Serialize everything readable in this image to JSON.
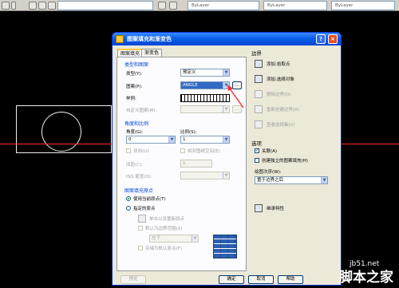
{
  "toolbar": {
    "combo_1": "",
    "combo_2": "ByLayer",
    "combo_3": "ByLayer",
    "combo_4": "ByLayer"
  },
  "dialog": {
    "title": "图案填充和渐变色",
    "help_label": "?",
    "close_label": "×",
    "tabs": [
      "图案填充",
      "渐变色"
    ],
    "type_group": {
      "title": "类型和图案",
      "type_label": "类型(Y):",
      "type_value": "预定义",
      "pattern_label": "图案(P):",
      "pattern_value": "ANGLE",
      "browse_label": "...",
      "sample_label": "样例:",
      "custom_label": "自定义图案(M):"
    },
    "angle_group": {
      "title": "角度和比例",
      "angle_label": "角度(G):",
      "angle_value": "0",
      "scale_label": "比例(S):",
      "scale_value": "1",
      "double_label": "双向(U)",
      "relative_label": "相对图纸空间(E)",
      "spacing_label": "间距(C):",
      "spacing_value": "1",
      "iso_label": "ISO 笔宽(O):"
    },
    "origin_group": {
      "title": "图案填充原点",
      "use_current": "使用当前原点(T)",
      "specified": "指定的原点",
      "click_set": "单击以设置新原点",
      "default_extent": "默认为边界范围(X)",
      "position_value": "左下",
      "store_default": "存储为默认原点(F)"
    },
    "boundary": {
      "title": "边界",
      "add_pick": "添加:拾取点",
      "add_select": "添加:选择对象",
      "remove": "删除边界(D)",
      "recreate": "重新创建边界(R)",
      "view": "查看选择集(V)"
    },
    "options": {
      "title": "选项",
      "associative": "关联(A)",
      "separate": "创建独立的图案填充(H)",
      "draw_order_label": "绘图次序(W):",
      "draw_order_value": "置于边界之后"
    },
    "inherit_label": "继承特性",
    "footer": {
      "preview": "预览",
      "ok": "确定",
      "cancel": "取消",
      "help": "帮助"
    }
  },
  "watermark": {
    "site": "jb51.net",
    "brand": "脚本之家"
  }
}
